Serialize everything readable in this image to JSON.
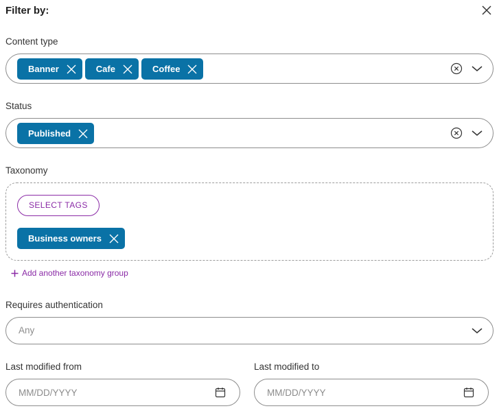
{
  "header": {
    "title": "Filter by:",
    "close_icon": "close-icon"
  },
  "content_type": {
    "label": "Content type",
    "chips": [
      "Banner",
      "Cafe",
      "Coffee"
    ]
  },
  "status": {
    "label": "Status",
    "chips": [
      "Published"
    ]
  },
  "taxonomy": {
    "label": "Taxonomy",
    "select_tags_label": "SELECT TAGS",
    "chips": [
      "Business owners"
    ],
    "add_group_label": "Add another taxonomy group"
  },
  "requires_auth": {
    "label": "Requires authentication",
    "value": "Any"
  },
  "last_modified_from": {
    "label": "Last modified from",
    "placeholder": "MM/DD/YYYY"
  },
  "last_modified_to": {
    "label": "Last modified to",
    "placeholder": "MM/DD/YYYY"
  },
  "colors": {
    "chip": "#0a72a6",
    "accent": "#8a2aa6",
    "border": "#8c8c8c"
  }
}
